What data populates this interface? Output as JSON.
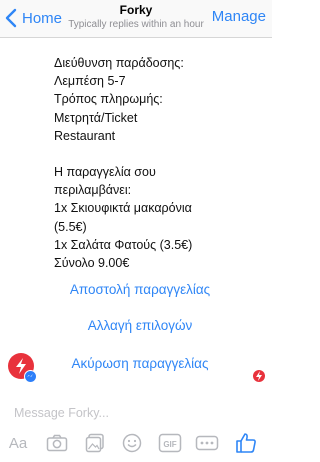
{
  "nav": {
    "back_label": "Home",
    "title": "Forky",
    "subtitle": "Typically replies within an hour",
    "manage_label": "Manage"
  },
  "message": {
    "lines": [
      "Διεύθυνση παράδοσης:",
      "Λεμπέση 5-7",
      "Τρόπος πληρωμής:",
      "Μετρητά/Ticket",
      "Restaurant",
      "",
      "Η παραγγελία σου",
      "περιλαμβάνει:",
      "1x Σκιουφικτά μακαρόνια",
      "(5.5€)",
      "1x Σαλάτα Φατούς (3.5€)",
      "Σύνολο 9.00€"
    ]
  },
  "actions": {
    "send_order": "Αποστολή παραγγελίας",
    "change_options": "Αλλαγή επιλογών",
    "cancel_order": "Ακύρωση παραγγελίας"
  },
  "composer": {
    "placeholder": "Message Forky...",
    "text_button": "Aa",
    "gif_label": "GIF"
  },
  "colors": {
    "accent": "#2f86f6",
    "brand": "#e8323c",
    "toolbar_icon": "#b6b8bd"
  }
}
